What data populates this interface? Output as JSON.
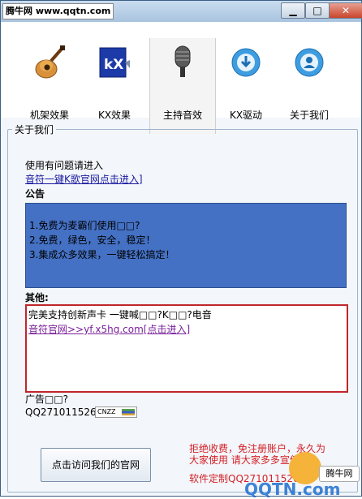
{
  "window": {
    "site_badge": "腾牛网 www.qqtn.com",
    "controls": {
      "minimize": "▁",
      "maximize": "□",
      "close": "✕"
    }
  },
  "toolbar": {
    "items": [
      {
        "label": "机架效果",
        "icon": "guitar-icon"
      },
      {
        "label": "KX效果",
        "icon": "kx-logo-icon"
      },
      {
        "label": "主持音效",
        "icon": "microphone-icon"
      },
      {
        "label": "KX驱动",
        "icon": "download-icon"
      },
      {
        "label": "关于我们",
        "icon": "user-icon"
      }
    ],
    "active_index": 2
  },
  "about": {
    "group_title": "关于我们",
    "intro": "使用有问题请进入",
    "kgroup_link": "音符一键K歌官网点击进入]",
    "notice_title": "公告",
    "notice_lines": [
      "1.免费为麦霸们使用□□?",
      "2.免费，绿色，安全，稳定！",
      "3.集成众多效果，一键轻松搞定！"
    ],
    "other_title": "其他:",
    "other_line1": "完美支持创新声卡 一键喊□□?K□□?电音",
    "other_link": "音符官网>>yf.x5hg.com[点击进入]",
    "ad_label": "广告□□?",
    "qq": "QQ271011526",
    "cnzz": "CNZZ",
    "visit_button": "点击访问我们的官网",
    "slogan1": "拒绝收费，免注册账户，永久为",
    "slogan2": "大家使用  请大家多多宣传!",
    "custom": "软件定制QQ271011526"
  },
  "watermark": {
    "brand": "腾牛网",
    "site": "QQTN.com"
  },
  "colors": {
    "notice_bg": "#4471c4",
    "other_border": "#c0262c",
    "slogan": "#d41f25"
  }
}
